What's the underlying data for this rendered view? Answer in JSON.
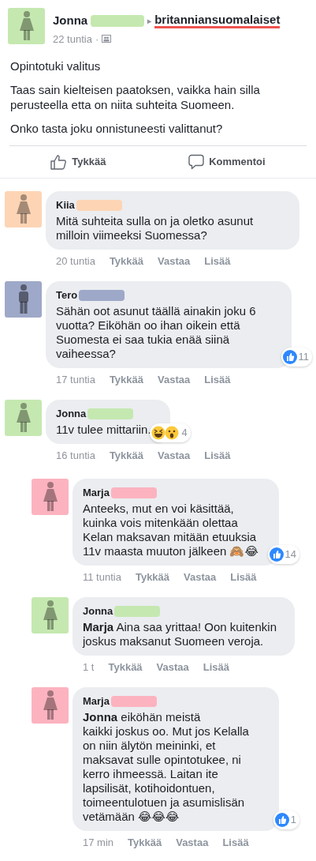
{
  "post": {
    "author": {
      "name": "Jonna",
      "color": "#c5e8b0",
      "kind": "female"
    },
    "separator_arrow": "▸",
    "group": "britanniansuomalaiset",
    "time": "22 tuntia",
    "dot": "·",
    "title": "Opintotuki valitus",
    "paragraphs": [
      "Taas sain kielteisen paatoksen, vaikka hain silla perusteella etta on niita suhteita Suomeen.",
      "Onko tasta joku onnistuneesti valittanut?"
    ],
    "actions": [
      {
        "kind": "like",
        "label": "Tykkää"
      },
      {
        "kind": "comment",
        "label": "Kommentoi"
      }
    ]
  },
  "comments": [
    {
      "name": "Kiia",
      "color": "#fdd5b5",
      "kind": "female",
      "text": "Mitä suhteita sulla on ja oletko asunut milloin viimeeksi Suomessa?",
      "time": "20 tuntia",
      "actions": [
        "Tykkää",
        "Vastaa",
        "Lisää"
      ]
    },
    {
      "name": "Tero",
      "color": "#9ea8c8",
      "kind": "male",
      "text": "Sähän oot asunut täällä ainakin joku 6 vuotta? Eiköhän oo ihan oikein että Suomesta ei saa tukia enää siinä vaiheessa?",
      "reactions": [
        {
          "kind": "like"
        }
      ],
      "reaction_count": "11",
      "time": "17 tuntia",
      "actions": [
        "Tykkää",
        "Vastaa",
        "Lisää"
      ]
    },
    {
      "name": "Jonna",
      "color": "#c5e8b0",
      "kind": "female",
      "text": "11v tulee mittariin.",
      "reactions": [
        {
          "kind": "haha"
        },
        {
          "kind": "wow"
        }
      ],
      "reaction_count": "4",
      "time": "16 tuntia",
      "actions": [
        "Tykkää",
        "Vastaa",
        "Lisää"
      ],
      "children": [
        {
          "name": "Marja",
          "color": "#fcb3bf",
          "kind": "female",
          "text": "Anteeks, mut en voi käsittää, kuinka vois mitenkään olettaa Kelan maksavan mitään etuuksia 11v maasta muuton jälkeen 🙈😂",
          "reactions": [
            {
              "kind": "like"
            }
          ],
          "reaction_count": "14",
          "time": "11 tuntia",
          "actions": [
            "Tykkää",
            "Vastaa",
            "Lisää"
          ]
        },
        {
          "name": "Jonna",
          "color": "#c5e8b0",
          "kind": "female",
          "text": "**Marja** Aina saa yrittaa! Oon kuitenkin joskus maksanut Suomeen veroja.",
          "time": "1 t",
          "actions": [
            "Tykkää",
            "Vastaa",
            "Lisää"
          ]
        },
        {
          "name": "Marja",
          "color": "#fcb3bf",
          "kind": "female",
          "text": "**Jonna** eiköhän meistä\nkaikki joskus oo. Mut jos Kelalla on niin älytön meininki, et maksavat sulle opintotukee, ni kerro ihmeessä. Laitan ite lapsilisät, kotihoidontuen, toimeentulotuen ja asumislisän vetämään 😂😂😂",
          "reactions": [
            {
              "kind": "like"
            }
          ],
          "reaction_count": "1",
          "time": "17 min",
          "actions": [
            "Tykkää",
            "Vastaa",
            "Lisää"
          ]
        }
      ]
    }
  ]
}
